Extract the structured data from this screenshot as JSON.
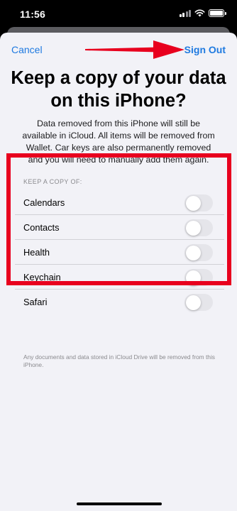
{
  "status_bar": {
    "time": "11:56",
    "icons": [
      "signal-icon",
      "wifi-icon",
      "battery-icon"
    ]
  },
  "nav": {
    "cancel_label": "Cancel",
    "sign_out_label": "Sign Out"
  },
  "title": "Keep a copy of your data on this iPhone?",
  "description": "Data removed from this iPhone will still be available in iCloud. All items will be removed from Wallet. Car keys are also permanently removed and you will need to manually add them again.",
  "section_header": "KEEP A COPY OF:",
  "items": [
    {
      "label": "Calendars",
      "enabled": false
    },
    {
      "label": "Contacts",
      "enabled": false
    },
    {
      "label": "Health",
      "enabled": false
    },
    {
      "label": "Keychain",
      "enabled": false
    },
    {
      "label": "Safari",
      "enabled": false
    }
  ],
  "footer_note": "Any documents and data stored in iCloud Drive will be removed from this iPhone.",
  "colors": {
    "accent": "#1f7ae0",
    "annotation_red": "#e8001e",
    "sheet_background": "#f2f2f7",
    "toggle_off": "#e5e5ea"
  }
}
